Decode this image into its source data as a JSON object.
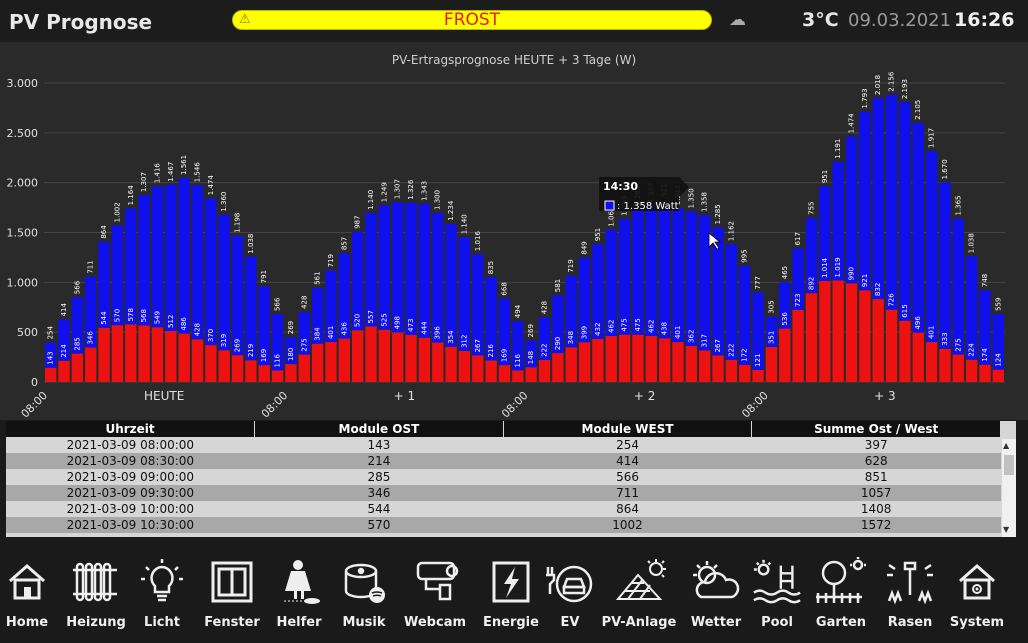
{
  "header": {
    "title": "PV Prognose",
    "alert_text": "FROST",
    "alert_icon": "warning-icon",
    "weather_icon": "cloud-icon",
    "temperature": "3°C",
    "date": "09.03.2021",
    "time": "16:26"
  },
  "chart_data": {
    "type": "bar",
    "stacked": true,
    "title": "PV-Ertragsprognose HEUTE + 3 Tage (W)",
    "ylim": [
      0,
      3000
    ],
    "y_ticks": [
      "0",
      "500",
      "1.000",
      "1.500",
      "2.000",
      "2.500",
      "3.000"
    ],
    "x_tick_labels": [
      "08:00",
      "08:00",
      "08:00",
      "08:00"
    ],
    "day_labels": [
      "HEUTE",
      "+ 1",
      "+ 2",
      "+ 3"
    ],
    "grid": true,
    "colors": {
      "ost": "#ee1111",
      "west": "#1010ee"
    },
    "series": [
      {
        "name": "Module OST",
        "days": [
          [
            143,
            214,
            285,
            346,
            544,
            570,
            578,
            568,
            549,
            512,
            486,
            428,
            370,
            319,
            269,
            219,
            169,
            116
          ],
          [
            180,
            275,
            384,
            401,
            436,
            520,
            557,
            525,
            498,
            473,
            444,
            396,
            354,
            312,
            267,
            216,
            169,
            116
          ],
          [
            148,
            222,
            290,
            348,
            399,
            432,
            462,
            475,
            475,
            462,
            438,
            401,
            362,
            317,
            267,
            222,
            172,
            121
          ],
          [
            351,
            536,
            723,
            892,
            1014,
            1019,
            990,
            921,
            832,
            726,
            615,
            496,
            401,
            333,
            275,
            224,
            174,
            124
          ]
        ]
      },
      {
        "name": "Module WEST",
        "days": [
          [
            254,
            414,
            566,
            711,
            864,
            1002,
            1164,
            1307,
            1416,
            1467,
            1561,
            1546,
            1474,
            1360,
            1198,
            1038,
            791,
            566
          ],
          [
            269,
            428,
            561,
            719,
            857,
            987,
            1140,
            1249,
            1307,
            1326,
            1343,
            1300,
            1234,
            1140,
            1016,
            835,
            668,
            494
          ],
          [
            269,
            428,
            581,
            719,
            849,
            951,
            1067,
            1163,
            1263,
            1307,
            1321,
            1343,
            1350,
            1358,
            1285,
            1162,
            995,
            777
          ],
          [
            305,
            465,
            617,
            755,
            951,
            1191,
            1474,
            1793,
            2018,
            2156,
            2193,
            2105,
            1917,
            1670,
            1365,
            1038,
            748,
            559
          ]
        ]
      }
    ],
    "tooltip": {
      "time": "14:30",
      "value": "1.358 Watt"
    }
  },
  "table": {
    "headers": [
      "Uhrzeit",
      "Module OST",
      "Module WEST",
      "Summe Ost / West"
    ],
    "rows": [
      [
        "2021-03-09 08:00:00",
        "143",
        "254",
        "397"
      ],
      [
        "2021-03-09 08:30:00",
        "214",
        "414",
        "628"
      ],
      [
        "2021-03-09 09:00:00",
        "285",
        "566",
        "851"
      ],
      [
        "2021-03-09 09:30:00",
        "346",
        "711",
        "1057"
      ],
      [
        "2021-03-09 10:00:00",
        "544",
        "864",
        "1408"
      ],
      [
        "2021-03-09 10:30:00",
        "570",
        "1002",
        "1572"
      ]
    ],
    "scroll_up": "▲",
    "scroll_down": "▼"
  },
  "nav": {
    "items": [
      {
        "label": "Home",
        "icon": "home-icon"
      },
      {
        "label": "Heizung",
        "icon": "radiator-icon"
      },
      {
        "label": "Licht",
        "icon": "bulb-icon"
      },
      {
        "label": "Fenster",
        "icon": "window-icon"
      },
      {
        "label": "Helfer",
        "icon": "robot-vacuum-icon"
      },
      {
        "label": "Musik",
        "icon": "speaker-icon"
      },
      {
        "label": "Webcam",
        "icon": "camera-icon"
      },
      {
        "label": "Energie",
        "icon": "lightning-icon"
      },
      {
        "label": "EV",
        "icon": "ev-car-icon"
      },
      {
        "label": "PV-Anlage",
        "icon": "solar-panel-icon"
      },
      {
        "label": "Wetter",
        "icon": "weather-icon"
      },
      {
        "label": "Pool",
        "icon": "pool-icon"
      },
      {
        "label": "Garten",
        "icon": "garden-icon"
      },
      {
        "label": "Rasen",
        "icon": "sprinkler-icon"
      },
      {
        "label": "System",
        "icon": "system-home-icon"
      }
    ],
    "active": "PV-Anlage"
  }
}
